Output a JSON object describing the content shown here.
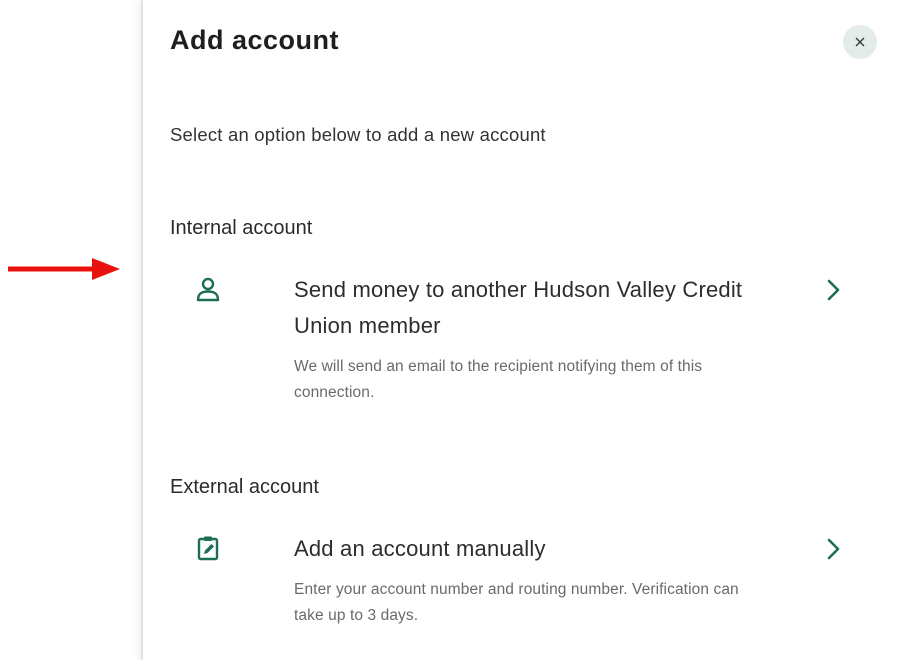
{
  "dialog": {
    "title": "Add account",
    "close_icon": "close-icon",
    "subtitle": "Select an option below to add a new account"
  },
  "sections": [
    {
      "heading": "Internal account",
      "option": {
        "icon": "person-icon",
        "title": "Send money to another Hudson Valley Credit Union member",
        "description": "We will send an email to the recipient notifying them of this connection.",
        "chevron": "chevron-right-icon"
      }
    },
    {
      "heading": "External account",
      "option": {
        "icon": "clipboard-edit-icon",
        "title": "Add an account manually",
        "description": "Enter your account number and routing number. Verification can take up to 3 days.",
        "chevron": "chevron-right-icon"
      }
    }
  ],
  "annotation": {
    "icon": "red-arrow-icon",
    "color": "#e8130f"
  },
  "colors": {
    "accent": "#1b6e57",
    "close_bg": "#e4ecea"
  }
}
